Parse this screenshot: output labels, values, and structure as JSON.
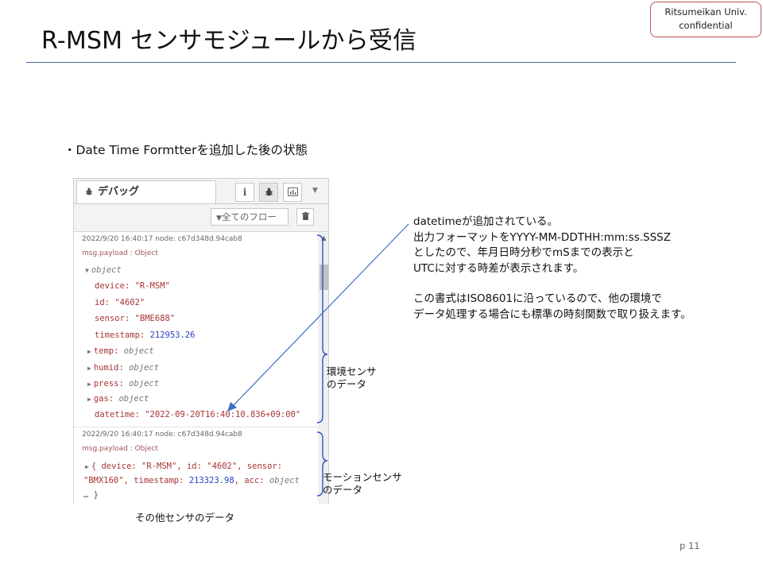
{
  "slide": {
    "title": "R-MSM センサモジュールから受信",
    "confidential_line1": "Ritsumeikan Univ.",
    "confidential_line2": "confidential",
    "bullet": "・Date Time Formtterを追加した後の状態",
    "page": "p 11"
  },
  "panel": {
    "tab_label": "デバッグ",
    "tab_icon": "bug-icon",
    "info_icon": "info-icon",
    "debug_icon": "bug-icon",
    "chart_icon": "chart-icon",
    "menu_icon": "chevron-down-icon",
    "filter_label": "全てのフロー",
    "filter_icon": "filter-icon",
    "trash_icon": "trash-icon"
  },
  "msg1": {
    "meta": "2022/9/20 16:40:17   node: c67d348d.94cab8",
    "payload_type": "msg.payload : Object",
    "object_label": "object",
    "fields": [
      {
        "key": "device",
        "value": "\"R-MSM\"",
        "kind": "s"
      },
      {
        "key": "id",
        "value": "\"4602\"",
        "kind": "s"
      },
      {
        "key": "sensor",
        "value": "\"BME688\"",
        "kind": "s"
      },
      {
        "key": "timestamp",
        "value": "212953.26",
        "kind": "n"
      },
      {
        "key": "temp",
        "value": "object",
        "kind": "o"
      },
      {
        "key": "humid",
        "value": "object",
        "kind": "o"
      },
      {
        "key": "press",
        "value": "object",
        "kind": "o"
      },
      {
        "key": "gas",
        "value": "object",
        "kind": "o"
      },
      {
        "key": "datetime",
        "value": "\"2022-09-20T16:40:10.836+09:00\"",
        "kind": "s"
      }
    ]
  },
  "msg2": {
    "meta": "2022/9/20 16:40:17   node: c67d348d.94cab8",
    "payload_type": "msg.payload : Object",
    "line1_a": "{ device: ",
    "line1_b": "\"R-MSM\"",
    "line1_c": ", id: ",
    "line1_d": "\"4602\"",
    "line1_e": ", sensor: ",
    "line2_a": "\"BMX160\"",
    "line2_b": ", timestamp: ",
    "line2_c": "213323.98",
    "line2_d": ", acc: ",
    "line2_e": "object",
    "line3": "… }"
  },
  "annotations": {
    "env_1": "環境センサ",
    "env_2": "のデータ",
    "motion_1": "モーションセンサ",
    "motion_2": "のデータ",
    "other": "その他センサのデータ"
  },
  "note": {
    "l1": "datetimeが追加されている。",
    "l2": "出力フォーマットをYYYY-MM-DDTHH:mm:ss.SSSZ",
    "l3": "としたので、年月日時分秒でmSまでの表示と",
    "l4": "UTCに対する時差が表示されます。",
    "l5": "この書式はISO8601に沿っているので、他の環境で",
    "l6": "データ処理する場合にも標準の時刻関数で取り扱えます。"
  },
  "colors": {
    "accent_rule": "#3f6f9b",
    "bracket": "#2a55c8",
    "arrow": "#3a6fc4",
    "badge_border": "#c0504d"
  }
}
